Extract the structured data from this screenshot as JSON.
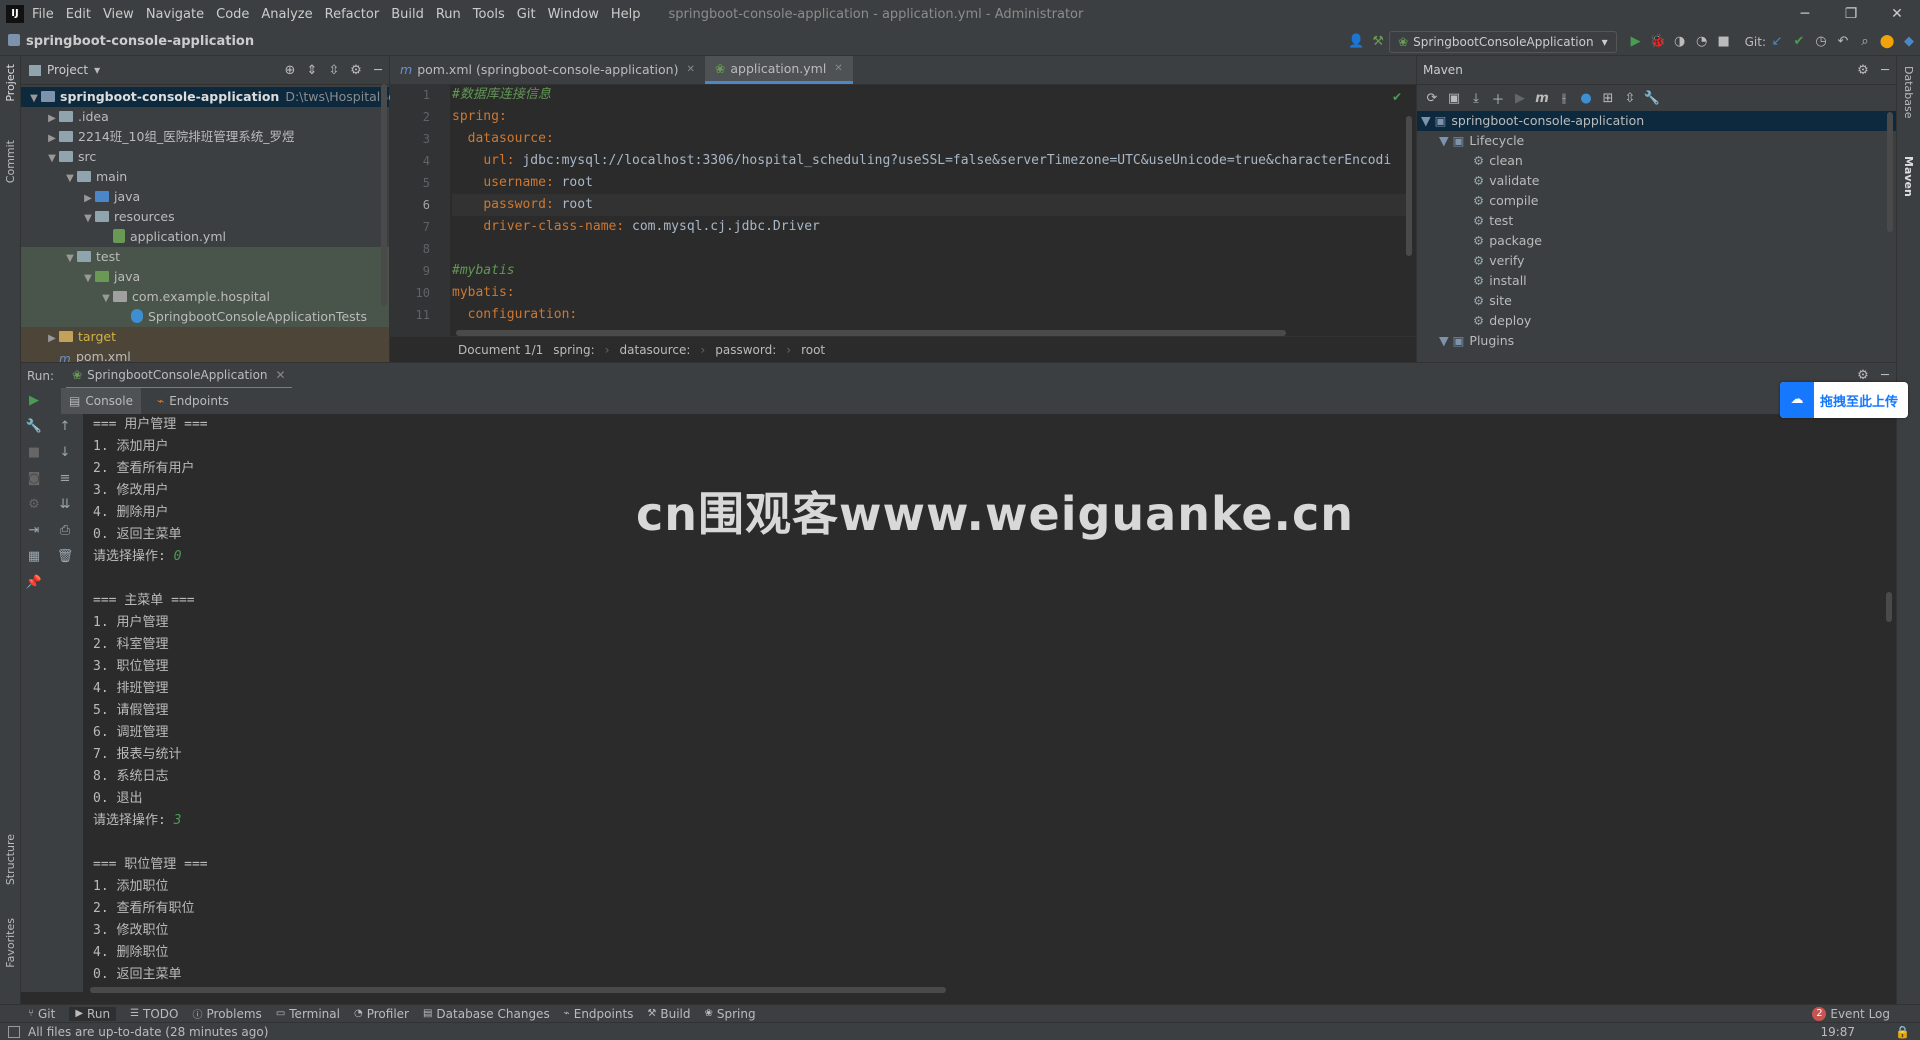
{
  "menubar": {
    "logo": "IJ",
    "items": [
      "File",
      "Edit",
      "View",
      "Navigate",
      "Code",
      "Analyze",
      "Refactor",
      "Build",
      "Run",
      "Tools",
      "Git",
      "Window",
      "Help"
    ],
    "title": "springboot-console-application - application.yml - Administrator"
  },
  "navbar": {
    "project_name": "springboot-console-application",
    "run_config": "SpringbootConsoleApplication",
    "git_label": "Git:"
  },
  "left_stripe": {
    "project": "Project",
    "commit": "Commit",
    "structure": "Structure",
    "favorites": "Favorites"
  },
  "right_stripe": {
    "database": "Database",
    "maven": "Maven"
  },
  "project_panel": {
    "title": "Project",
    "tree": [
      {
        "label": "springboot-console-application",
        "extra": "D:\\tws\\HospitalSched",
        "depth": 0,
        "open": true,
        "icon": "module"
      },
      {
        "label": ".idea",
        "depth": 1,
        "open": false,
        "icon": "folder"
      },
      {
        "label": "2214班_10组_医院排班管理系统_罗煜",
        "depth": 1,
        "open": false,
        "icon": "folder"
      },
      {
        "label": "src",
        "depth": 1,
        "open": true,
        "icon": "folder"
      },
      {
        "label": "main",
        "depth": 2,
        "open": true,
        "icon": "folder"
      },
      {
        "label": "java",
        "depth": 3,
        "open": false,
        "icon": "folder-blue"
      },
      {
        "label": "resources",
        "depth": 3,
        "open": true,
        "icon": "folder-res"
      },
      {
        "label": "application.yml",
        "depth": 4,
        "icon": "yml"
      },
      {
        "label": "test",
        "depth": 2,
        "open": true,
        "icon": "folder"
      },
      {
        "label": "java",
        "depth": 3,
        "open": true,
        "icon": "folder-green"
      },
      {
        "label": "com.example.hospital",
        "depth": 4,
        "open": true,
        "icon": "package"
      },
      {
        "label": "SpringbootConsoleApplicationTests",
        "depth": 5,
        "icon": "class"
      },
      {
        "label": "target",
        "depth": 1,
        "open": false,
        "icon": "folder-orange"
      },
      {
        "label": "pom.xml",
        "depth": 1,
        "icon": "maven"
      }
    ]
  },
  "editor": {
    "tabs": [
      {
        "label": "pom.xml (springboot-console-application)",
        "active": false
      },
      {
        "label": "application.yml",
        "active": true
      }
    ],
    "line_numbers": [
      "1",
      "2",
      "3",
      "4",
      "5",
      "6",
      "7",
      "8",
      "9",
      "10",
      "11"
    ],
    "lines": [
      {
        "indent": "",
        "key": "",
        "value": "",
        "comment": "#数据库连接信息"
      },
      {
        "indent": "",
        "key": "spring",
        "value": "",
        "comment": ""
      },
      {
        "indent": "  ",
        "key": "datasource",
        "value": "",
        "comment": ""
      },
      {
        "indent": "    ",
        "key": "url",
        "value": " jdbc:mysql://localhost:3306/hospital_scheduling?useSSL=false&serverTimezone=UTC&useUnicode=true&characterEncodi",
        "comment": ""
      },
      {
        "indent": "    ",
        "key": "username",
        "value": " root",
        "comment": ""
      },
      {
        "indent": "    ",
        "key": "password",
        "value": " root",
        "comment": ""
      },
      {
        "indent": "    ",
        "key": "driver-class-name",
        "value": " com.mysql.cj.jdbc.Driver",
        "comment": ""
      },
      {
        "indent": "",
        "key": "",
        "value": "",
        "comment": ""
      },
      {
        "indent": "",
        "key": "",
        "value": "",
        "comment": "#mybatis"
      },
      {
        "indent": "",
        "key": "mybatis",
        "value": "",
        "comment": ""
      },
      {
        "indent": "  ",
        "key": "configuration",
        "value": "",
        "comment": ""
      }
    ],
    "breadcrumb": [
      "Document 1/1",
      "spring:",
      "datasource:",
      "password:",
      "root"
    ]
  },
  "maven": {
    "title": "Maven",
    "root": "springboot-console-application",
    "lifecycle_label": "Lifecycle",
    "goals": [
      "clean",
      "validate",
      "compile",
      "test",
      "package",
      "verify",
      "install",
      "site",
      "deploy"
    ],
    "plugins_label": "Plugins"
  },
  "run": {
    "label": "Run:",
    "config": "SpringbootConsoleApplication",
    "tabs": [
      "Console",
      "Endpoints"
    ],
    "console_lines": [
      {
        "text": "=== 用户管理 ===",
        "input": ""
      },
      {
        "text": "1. 添加用户",
        "input": ""
      },
      {
        "text": "2. 查看所有用户",
        "input": ""
      },
      {
        "text": "3. 修改用户",
        "input": ""
      },
      {
        "text": "4. 删除用户",
        "input": ""
      },
      {
        "text": "0. 返回主菜单",
        "input": ""
      },
      {
        "text": "请选择操作: ",
        "input": "0"
      },
      {
        "text": "",
        "input": ""
      },
      {
        "text": "=== 主菜单 ===",
        "input": ""
      },
      {
        "text": "1. 用户管理",
        "input": ""
      },
      {
        "text": "2. 科室管理",
        "input": ""
      },
      {
        "text": "3. 职位管理",
        "input": ""
      },
      {
        "text": "4. 排班管理",
        "input": ""
      },
      {
        "text": "5. 请假管理",
        "input": ""
      },
      {
        "text": "6. 调班管理",
        "input": ""
      },
      {
        "text": "7. 报表与统计",
        "input": ""
      },
      {
        "text": "8. 系统日志",
        "input": ""
      },
      {
        "text": "0. 退出",
        "input": ""
      },
      {
        "text": "请选择操作: ",
        "input": "3"
      },
      {
        "text": "",
        "input": ""
      },
      {
        "text": "=== 职位管理 ===",
        "input": ""
      },
      {
        "text": "1. 添加职位",
        "input": ""
      },
      {
        "text": "2. 查看所有职位",
        "input": ""
      },
      {
        "text": "3. 修改职位",
        "input": ""
      },
      {
        "text": "4. 删除职位",
        "input": ""
      },
      {
        "text": "0. 返回主菜单",
        "input": ""
      }
    ]
  },
  "bottom_tools": [
    "Git",
    "Run",
    "TODO",
    "Problems",
    "Terminal",
    "Profiler",
    "Database Changes",
    "Endpoints",
    "Build",
    "Spring"
  ],
  "event_log": {
    "count": "2",
    "label": "Event Log"
  },
  "status": {
    "message": "All files are up-to-date (28 minutes ago)",
    "time": "19:87"
  },
  "watermark": "cn围观客www.weiguanke.cn",
  "upload_widget": "拖拽至此上传",
  "colors": {
    "accent": "#4a88c7",
    "keyword": "#cc7832",
    "comment": "#629755",
    "input_green": "#499c54",
    "bg": "#2b2b2b",
    "panel": "#3c3f41"
  }
}
